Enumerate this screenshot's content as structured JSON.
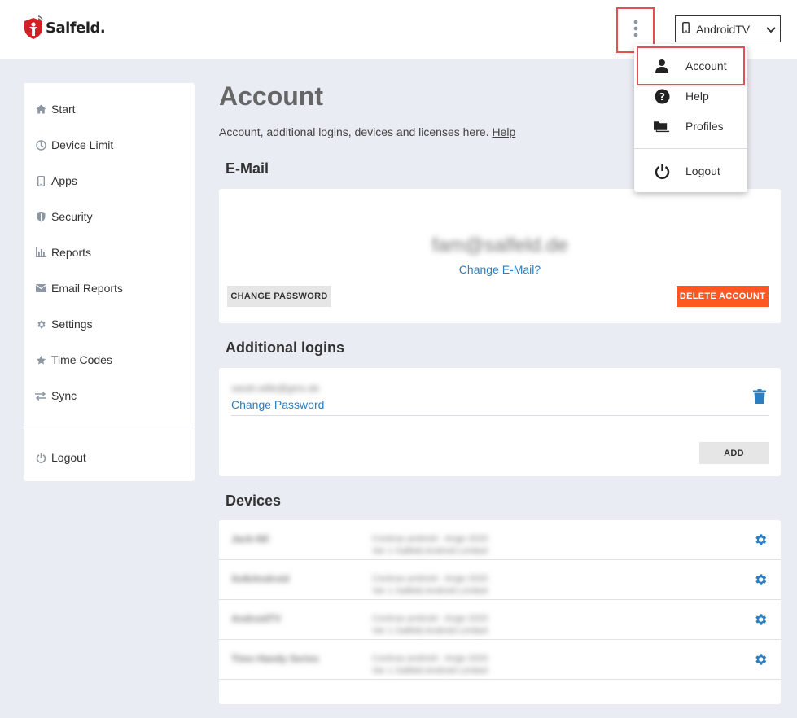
{
  "header": {
    "logo_text": "Salfeld.",
    "device_selector": "AndroidTV"
  },
  "sidebar": {
    "items": [
      {
        "label": "Start",
        "icon": "home-icon"
      },
      {
        "label": "Device Limit",
        "icon": "clock-icon"
      },
      {
        "label": "Apps",
        "icon": "phone-icon"
      },
      {
        "label": "Security",
        "icon": "shield-icon"
      },
      {
        "label": "Reports",
        "icon": "bar-chart-icon"
      },
      {
        "label": "Email Reports",
        "icon": "envelope-icon"
      },
      {
        "label": "Settings",
        "icon": "gear-icon"
      },
      {
        "label": "Time Codes",
        "icon": "star-icon"
      },
      {
        "label": "Sync",
        "icon": "sync-arrows-icon"
      }
    ],
    "logout_label": "Logout"
  },
  "main": {
    "title": "Account",
    "subtitle": "Account, additional logins, devices and licenses here.",
    "help_link": "Help",
    "email_section": {
      "heading": "E-Mail",
      "email_value": "fam@salfeld.de",
      "change_email_link": "Change E-Mail?",
      "change_password_button": "CHANGE PASSWORD",
      "delete_account_button": "DELETE ACCOUNT"
    },
    "logins_section": {
      "heading": "Additional logins",
      "login_value": "sarah.wille@gmx.de",
      "change_password_link": "Change Password",
      "add_button": "ADD"
    },
    "devices_section": {
      "heading": "Devices",
      "devices": [
        {
          "name": "Jack-Nil",
          "info1": "Cockrax.android - Ange 2020",
          "info2": "Ver 1 Salfeld.Android Limited"
        },
        {
          "name": "SolkAndroid",
          "info1": "Cockrax.android - Ange 2020",
          "info2": "Ver 1 Salfeld.Android Limited"
        },
        {
          "name": "AndroidTV",
          "info1": "Cockrax.android - Ange 2020",
          "info2": "Ver 1 Salfeld.Android Limited"
        },
        {
          "name": "Timo Handy Series",
          "info1": "Cockrax.android - Ange 2020",
          "info2": "Ver 1 Salfeld.Android Limited"
        }
      ]
    }
  },
  "dropdown": {
    "items": [
      {
        "label": "Account",
        "icon": "user-icon"
      },
      {
        "label": "Help",
        "icon": "question-circle-icon"
      },
      {
        "label": "Profiles",
        "icon": "folders-icon"
      },
      {
        "label": "Logout",
        "icon": "power-icon"
      }
    ]
  },
  "colors": {
    "accent_link": "#2b7fc1",
    "danger": "#ff5722",
    "highlight_box": "#e05252",
    "brand_red": "#d32027"
  }
}
